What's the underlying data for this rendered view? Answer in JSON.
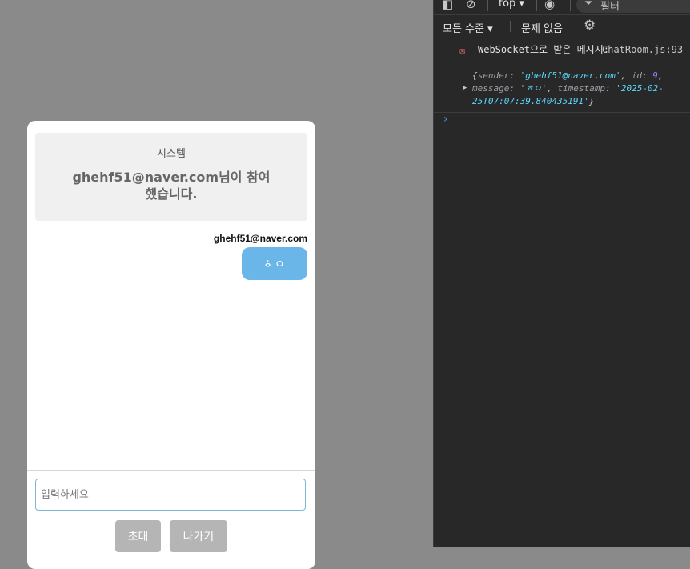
{
  "chat": {
    "system_sender": "시스템",
    "system_message": "ghehf51@naver.com님이 참여했습니다.",
    "message_sender": "ghehf51@naver.com",
    "message_text": "ㅎㅇ",
    "input_placeholder": "입력하세요",
    "invite_label": "초대",
    "leave_label": "나가기"
  },
  "devtools": {
    "context": "top",
    "filter_placeholder": "필터",
    "level_label": "모든 수준",
    "issues_label": "문제 없음",
    "log_text": "WebSocket으로 받은 메시지:",
    "log_source": "ChatRoom.js:93",
    "log_object": {
      "sender": "ghehf51@naver.com",
      "id": "9",
      "message": "ㅎㅇ",
      "timestamp": "2025-02-25T07:07:39.840435191"
    },
    "icons": [
      "sidebar-toggle-icon",
      "clear-console-icon",
      "eye-icon",
      "filter-icon",
      "gear-icon",
      "envelope-icon"
    ]
  },
  "colors": {
    "page_overlay": "#8a8a8a",
    "bubble": "#6bb6e8",
    "button": "#b5b5b5",
    "devtools_bg": "#282828"
  }
}
